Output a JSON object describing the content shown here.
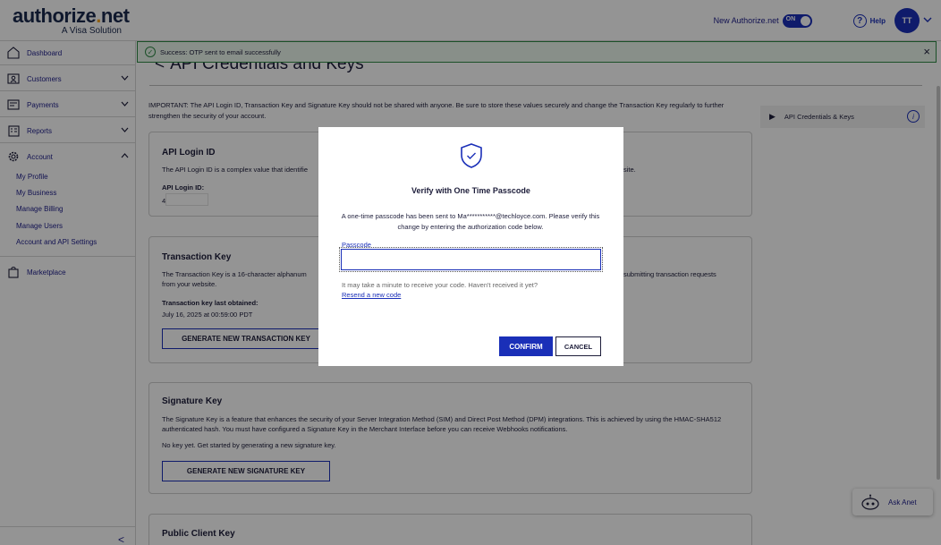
{
  "brand": {
    "logo_text": "authorize.net",
    "logo_sub": "A Visa Solution"
  },
  "header": {
    "new_anet_label": "New Authorize.net",
    "toggle_label": "ON",
    "help_label": "Help",
    "avatar_initials": "TT"
  },
  "sidebar": {
    "items": [
      {
        "label": "Dashboard",
        "icon": "home-icon"
      },
      {
        "label": "Customers",
        "icon": "customers-icon"
      },
      {
        "label": "Payments",
        "icon": "payments-icon"
      },
      {
        "label": "Reports",
        "icon": "reports-icon"
      },
      {
        "label": "Account",
        "icon": "gear-icon"
      }
    ],
    "account_subitems": [
      "My Profile",
      "My Business",
      "Manage Billing",
      "Manage Users",
      "Account and API Settings"
    ],
    "marketplace_label": "Marketplace",
    "collapse_glyph": "<"
  },
  "toast": {
    "message": "Success: OTP sent to email successfully",
    "close_glyph": "×"
  },
  "main": {
    "page_title": "API Credentials and Keys",
    "important_text": "IMPORTANT: The API Login ID, Transaction Key and Signature Key should not be shared with anyone. Be sure to store these values securely and change the Transaction Key regularly to further strengthen the security of your account.",
    "api_login": {
      "title": "API Login ID",
      "description": "The API Login ID is a complex value that identifie",
      "description_tail": "site.",
      "field_label": "API Login ID:",
      "value_prefix": "4"
    },
    "transaction_key": {
      "title": "Transaction Key",
      "description_left": "The Transaction Key is a 16-character alphanum",
      "description_right": "submitting transaction requests",
      "description_line2": "from your website.",
      "last_obtained_label": "Transaction key last obtained:",
      "last_obtained_value": "July 16, 2025 at 00:59:00 PDT",
      "button_label": "GENERATE NEW TRANSACTION KEY"
    },
    "signature_key": {
      "title": "Signature Key",
      "description": "The Signature Key is a feature that enhances the security of your Server Integration Method (SIM) and Direct Post Method (DPM) integrations. This is achieved by using the HMAC-SHA512 authenticated hash. You must have configured a Signature Key in the Merchant Interface before you can receive Webhooks notifications.",
      "no_key_text": "No key yet. Get started by generating a new signature key.",
      "button_label": "GENERATE NEW SIGNATURE KEY"
    },
    "public_client_key": {
      "title": "Public Client Key"
    }
  },
  "right_panel": {
    "label": "API Credentials & Keys",
    "info_glyph": "i"
  },
  "ask_anet": {
    "label": "Ask Anet"
  },
  "modal": {
    "title": "Verify with One Time Passcode",
    "message": "A one-time passcode has been sent to Ma***********@techloyce.com. Please verify this change by entering the authorization code below.",
    "passcode_label": "Passcode",
    "passcode_value": "",
    "hint": "It may take a minute to receive your code. Haven't received it yet?",
    "resend_label": "Resend a new code",
    "confirm_label": "CONFIRM",
    "cancel_label": "CANCEL"
  },
  "colors": {
    "brand_blue": "#1a2fb8",
    "success_green": "#2f8a46",
    "logo_dot": "#f6a623"
  }
}
